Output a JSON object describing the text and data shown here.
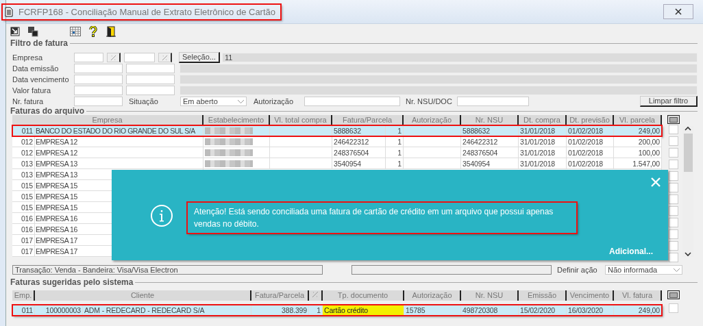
{
  "window": {
    "title": "FCRFP168 - Conciliação Manual de Extrato Eletrônico de Cartão",
    "annotated": true
  },
  "filter": {
    "title": "Filtro de fatura",
    "labels": [
      "Empresa",
      "Data emissão",
      "Data vencimento",
      "Valor fatura",
      "Nr. fatura"
    ],
    "selection_button": "Seleção...",
    "company_summary": "11",
    "status_label": "Situação",
    "status": "Em aberto",
    "authorization_label": "Autorização",
    "nsu_label": "Nr. NSU/DOC",
    "clear_button": "Limpar filtro"
  },
  "file_invoices": {
    "title": "Faturas do arquivo",
    "columns": [
      "Empresa",
      "Estabelecimento",
      "Vl. total compra",
      "Fatura/Parcela",
      "Autorização",
      "Nr. NSU",
      "Dt. compra",
      "Dt. previsão",
      "Vl. parcela"
    ],
    "rows": [
      {
        "code": "011",
        "company": "BANCO DO ESTADO DO RIO GRANDE DO SUL S/A",
        "redacted": true,
        "invoice": "5888632",
        "installment": "1",
        "nsu": "5888632",
        "purchase_date": "31/01/2018",
        "forecast_date": "01/02/2018",
        "amount": "249,00",
        "selected": true,
        "annotated": true,
        "checked": false
      },
      {
        "code": "012",
        "company": "EMPRESA 12",
        "redacted": true,
        "invoice": "246422312",
        "installment": "1",
        "nsu": "246422312",
        "purchase_date": "31/01/2018",
        "forecast_date": "01/02/2018",
        "amount": "200,00",
        "selected": false,
        "annotated": false,
        "checked": false
      },
      {
        "code": "012",
        "company": "EMPRESA 12",
        "redacted": true,
        "invoice": "248376504",
        "installment": "1",
        "nsu": "248376504",
        "purchase_date": "31/01/2018",
        "forecast_date": "01/02/2018",
        "amount": "100,00",
        "selected": false,
        "annotated": false,
        "checked": false
      },
      {
        "code": "013",
        "company": "EMPRESA 13",
        "redacted": true,
        "invoice": "3540954",
        "installment": "1",
        "nsu": "3540954",
        "purchase_date": "31/01/2018",
        "forecast_date": "01/02/2018",
        "amount": "1.547,00",
        "selected": false,
        "annotated": false,
        "checked": false
      },
      {
        "code": "013",
        "company": "EMPRESA 13",
        "selected": false,
        "annotated": false,
        "checked": false
      },
      {
        "code": "015",
        "company": "EMPRESA 15",
        "selected": false,
        "annotated": false,
        "checked": false
      },
      {
        "code": "015",
        "company": "EMPRESA 15",
        "selected": false,
        "annotated": false,
        "checked": false
      },
      {
        "code": "015",
        "company": "EMPRESA 15",
        "selected": false,
        "annotated": false,
        "checked": false
      },
      {
        "code": "016",
        "company": "EMPRESA 16",
        "selected": false,
        "annotated": false,
        "checked": false
      },
      {
        "code": "016",
        "company": "EMPRESA 16",
        "selected": false,
        "annotated": false,
        "checked": false
      },
      {
        "code": "017",
        "company": "EMPRESA 17",
        "selected": false,
        "annotated": false,
        "checked": false
      },
      {
        "code": "017",
        "company": "EMPRESA 17",
        "selected": false,
        "annotated": false,
        "checked": false
      }
    ],
    "transaction": "Transação: Venda - Bandeira: Visa/Visa Electron",
    "action_label": "Definir ação",
    "action": "Não informada"
  },
  "suggested_invoices": {
    "title": "Faturas sugeridas pelo sistema",
    "columns": [
      "Emp.",
      "Cliente",
      "Fatura/Parcela",
      "Tp. documento",
      "Autorização",
      "Nr. NSU",
      "Emissão",
      "Vencimento",
      "Vl. fatura"
    ],
    "rows": [
      {
        "company": "011",
        "client_code": "100000003",
        "client": "ADM - REDECARD - REDECARD S/A",
        "invoice": "388.399",
        "installment": "1",
        "doc_type": "Cartão crédito",
        "doc_type_highlighted": true,
        "authorization": "15785",
        "nsu": "498720308",
        "issue_date": "15/02/2020",
        "due_date": "16/03/2020",
        "amount": "249,00",
        "selected": true,
        "annotated": true,
        "checked": false
      }
    ]
  },
  "toast": {
    "message": "Atenção! Está sendo conciliada uma fatura de cartão de crédito em um arquivo que possui apenas vendas no débito.",
    "message_annotated": true,
    "link": "Adicional..."
  }
}
